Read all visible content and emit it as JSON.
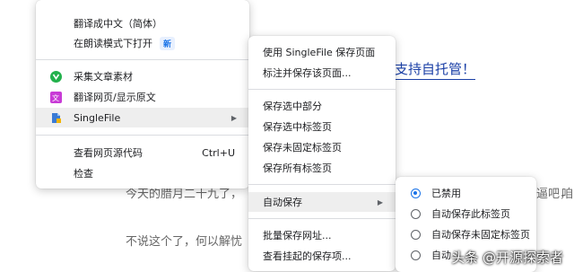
{
  "page": {
    "link_text": "支持自托管！",
    "line1_left": "今天的腊月二十九了，",
    "line1_right1": "逼吧，",
    "line1_right2": "咱",
    "line2": "不说这个了，何以解忧"
  },
  "main_menu": {
    "items": [
      {
        "label": "翻译成中文（简体）"
      },
      {
        "label": "在朗读模式下打开",
        "badge": "新"
      },
      {
        "label": "采集文章素材",
        "icon": "article-collector-icon"
      },
      {
        "label": "翻译网页/显示原文",
        "icon": "translate-icon"
      },
      {
        "label": "SingleFile",
        "icon": "singlefile-icon"
      },
      {
        "label": "查看网页源代码",
        "shortcut": "Ctrl+U"
      },
      {
        "label": "检查"
      }
    ]
  },
  "singlefile_menu": {
    "items": [
      {
        "label": "使用 SingleFile 保存页面"
      },
      {
        "label": "标注并保存该页面..."
      },
      {
        "label": "保存选中部分"
      },
      {
        "label": "保存选中标签页"
      },
      {
        "label": "保存未固定标签页"
      },
      {
        "label": "保存所有标签页"
      },
      {
        "label": "自动保存"
      },
      {
        "label": "批量保存网址..."
      },
      {
        "label": "查看挂起的保存项..."
      }
    ]
  },
  "autosave_menu": {
    "items": [
      {
        "label": "已禁用",
        "selected": true
      },
      {
        "label": "自动保存此标签页",
        "selected": false
      },
      {
        "label": "自动保存未固定标签页",
        "selected": false
      },
      {
        "label": "自动",
        "selected": false
      }
    ]
  },
  "watermark": "头条 @开源探索者",
  "colors": {
    "accent": "#1a73e8",
    "highlight": "#eeeeee"
  }
}
